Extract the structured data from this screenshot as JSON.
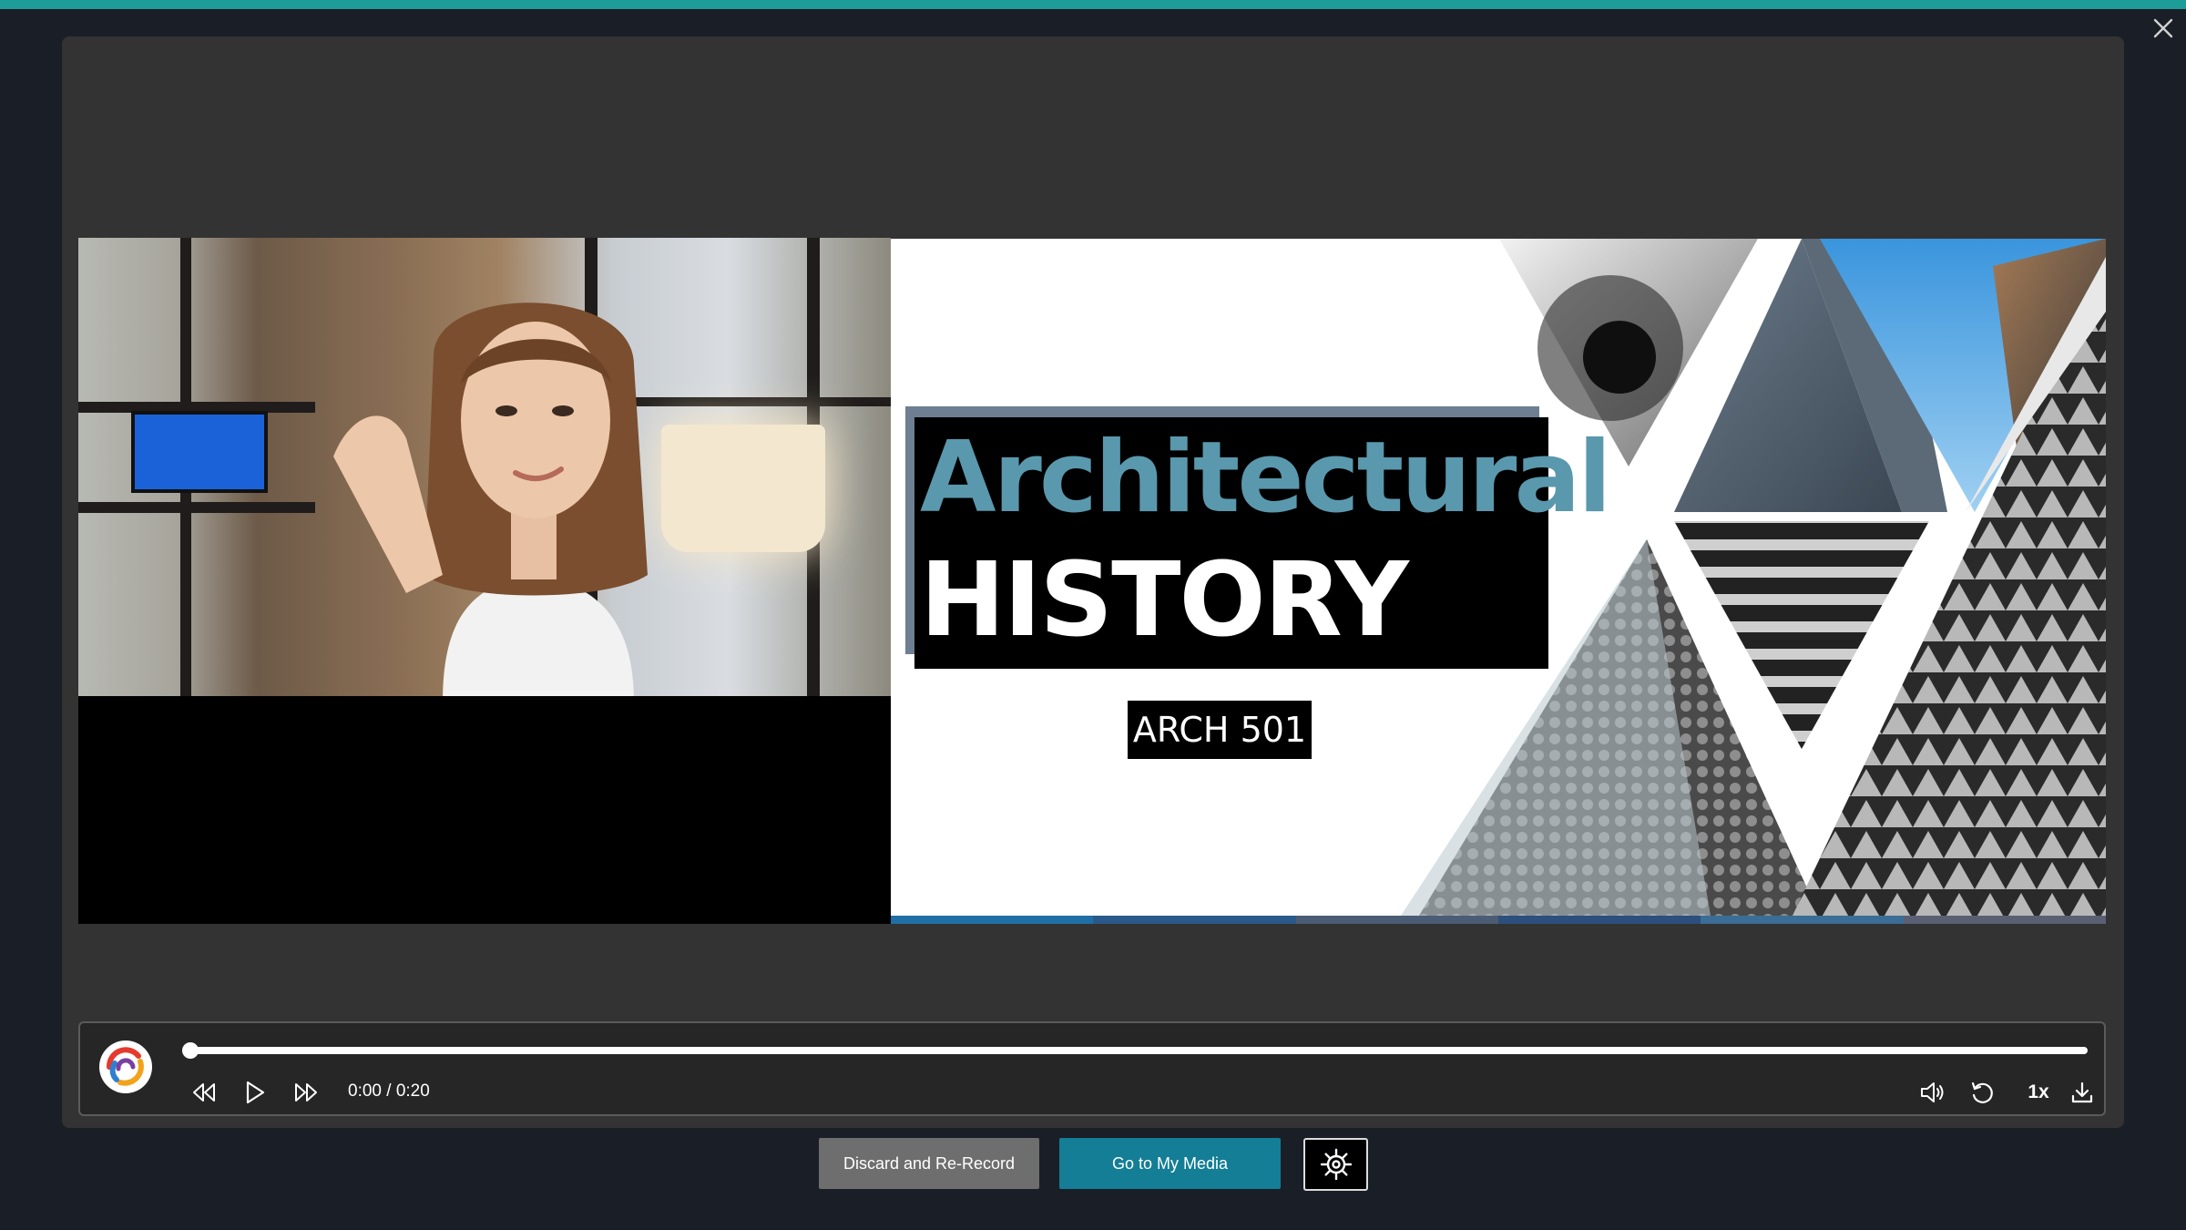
{
  "window": {
    "accent_color": "#1e9c9a",
    "close_icon": "close-icon"
  },
  "slide": {
    "title_line1": "Architectural",
    "title_line2": "HISTORY",
    "course_code": "ARCH 501",
    "title_color": "#5a98ad"
  },
  "player": {
    "time_display": "0:00 / 0:20",
    "speed": "1x",
    "progress": 0,
    "controls": {
      "rewind": "rewind-icon",
      "play": "play-icon",
      "forward": "fast-forward-icon",
      "volume": "volume-icon",
      "replay": "replay-icon",
      "download": "download-icon"
    }
  },
  "actions": {
    "discard_label": "Discard and Re-Record",
    "media_label": "Go to My Media",
    "settings_icon": "gear-icon",
    "media_button_color": "#137e95"
  }
}
